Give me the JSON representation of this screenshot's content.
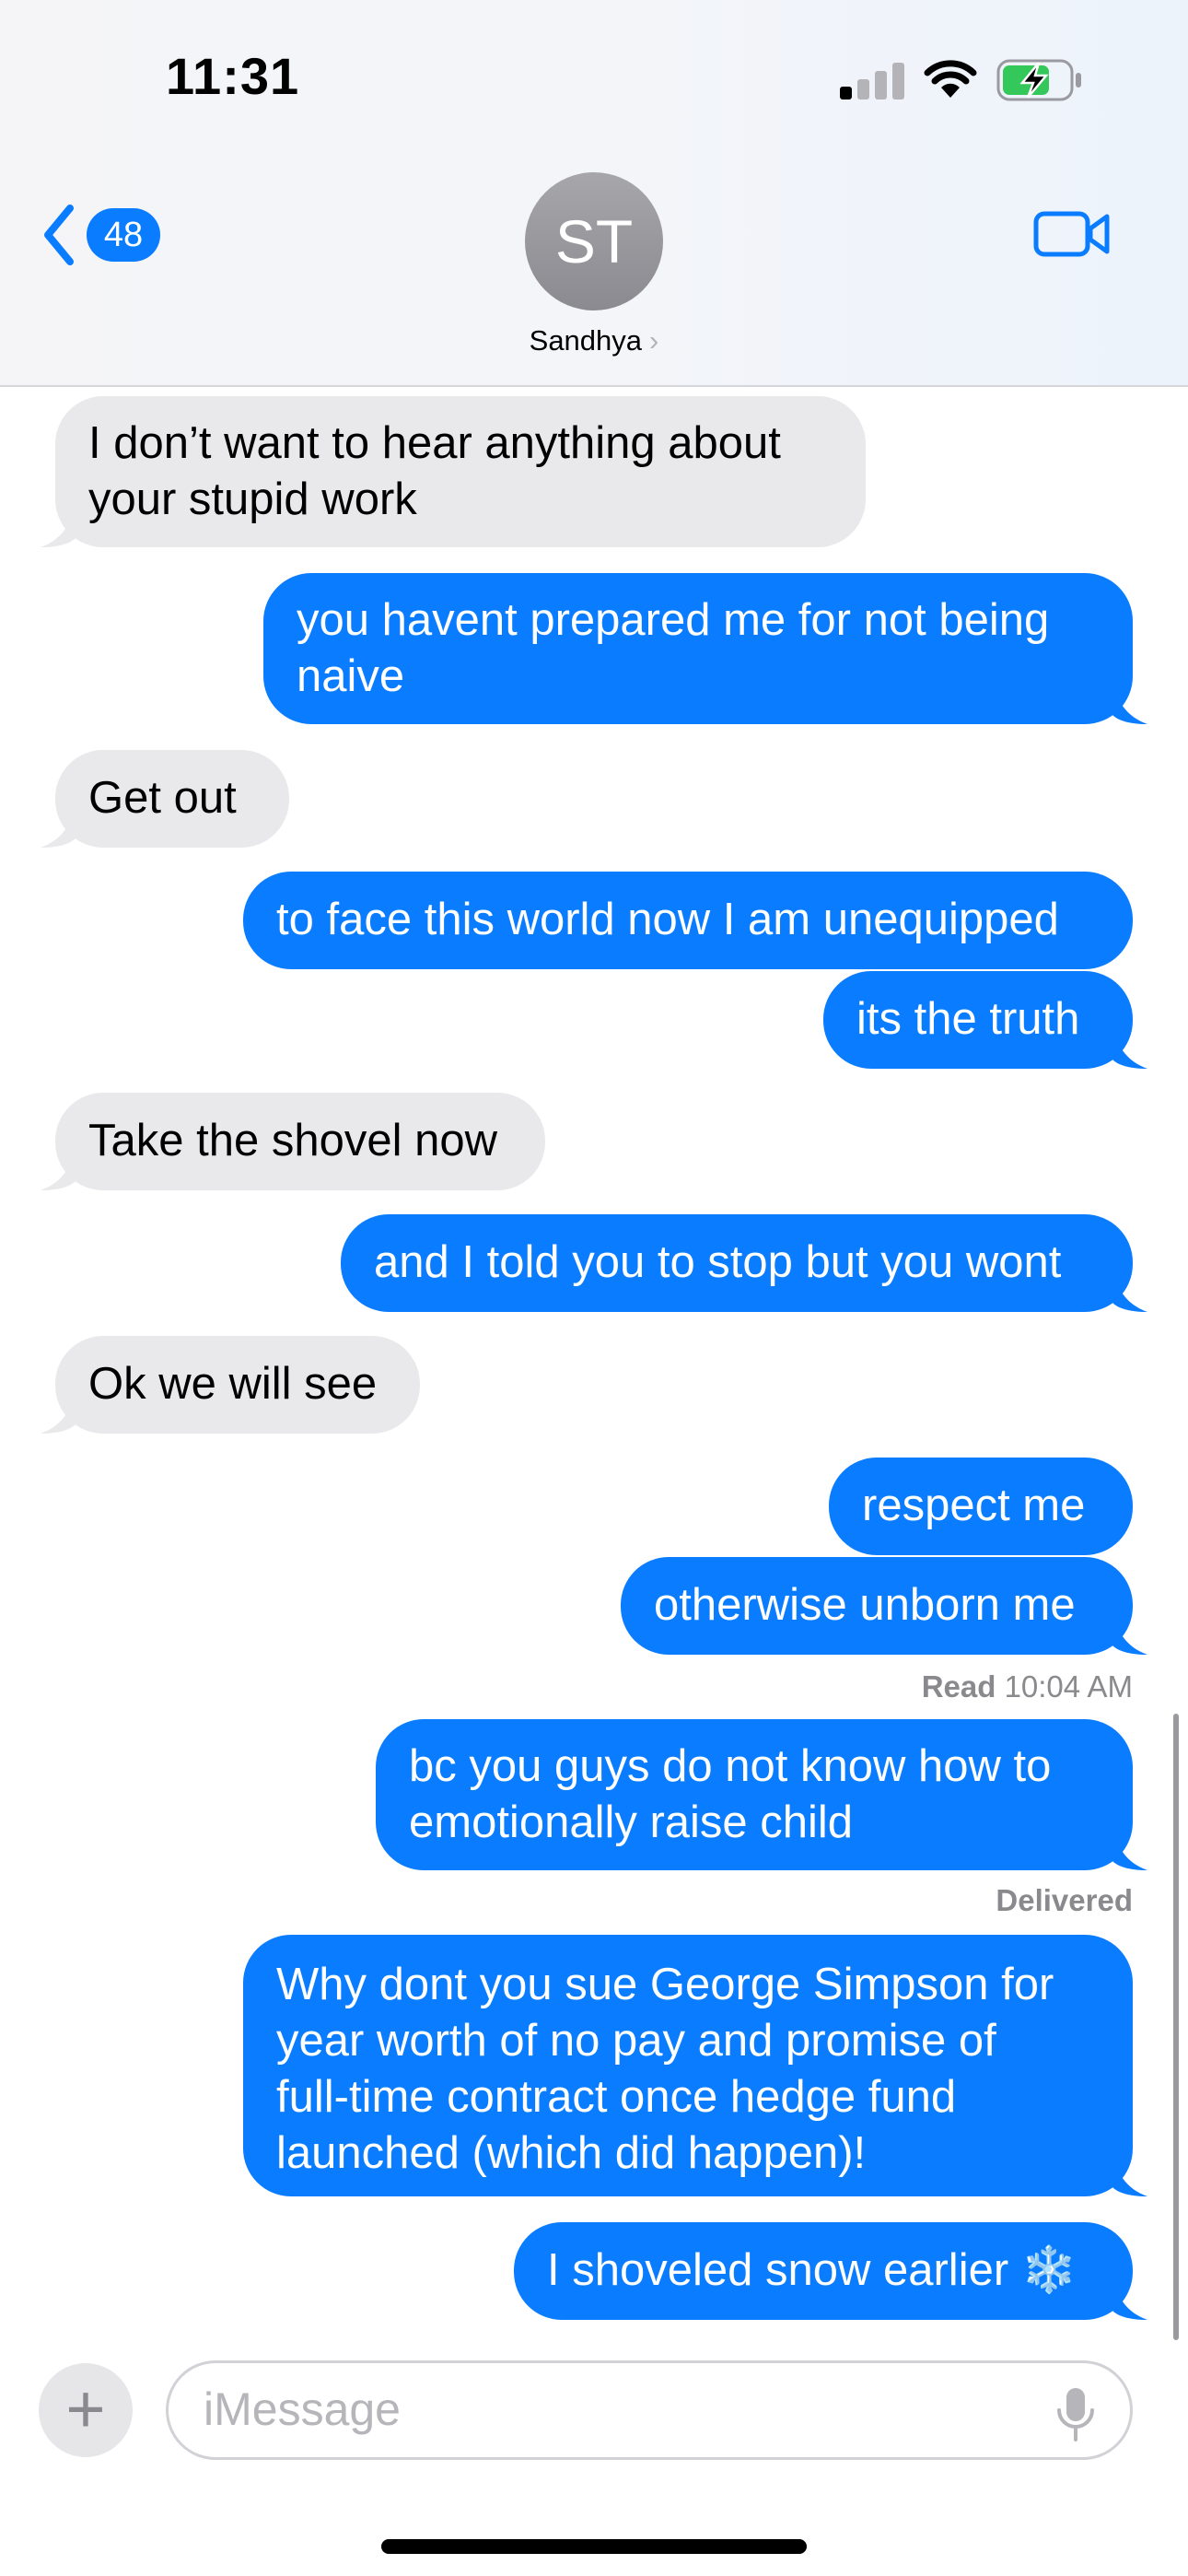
{
  "status_bar": {
    "time": "11:31"
  },
  "nav": {
    "back_count": "48",
    "avatar_initials": "ST",
    "contact_name": "Sandhya",
    "chevron": "›"
  },
  "messages": [
    {
      "from": "them",
      "lines": [
        "I don’t want to hear anything about",
        "your stupid work"
      ]
    },
    {
      "from": "me",
      "lines": [
        "you havent prepared me for not being",
        "naive"
      ]
    },
    {
      "from": "them",
      "lines": [
        "Get out"
      ]
    },
    {
      "from": "me",
      "lines": [
        "to face this world now I am unequipped"
      ]
    },
    {
      "from": "me",
      "lines": [
        "its the truth"
      ]
    },
    {
      "from": "them",
      "lines": [
        "Take the shovel now"
      ]
    },
    {
      "from": "me",
      "lines": [
        "and I told you to stop but you wont"
      ]
    },
    {
      "from": "them",
      "lines": [
        "Ok we will see"
      ]
    },
    {
      "from": "me",
      "lines": [
        "respect me"
      ]
    },
    {
      "from": "me",
      "lines": [
        "otherwise unborn me"
      ]
    },
    {
      "from": "me",
      "lines": [
        "bc you guys do not know how to",
        "emotionally raise child"
      ]
    },
    {
      "from": "me",
      "lines": [
        "Why dont you sue George Simpson for",
        "year worth of no pay and promise of",
        "full-time contract once hedge fund",
        "launched (which did happen)!"
      ]
    },
    {
      "from": "me",
      "lines": [
        "I shoveled snow earlier ❄️"
      ]
    }
  ],
  "receipts": {
    "read_label": "Read",
    "read_time": "10:04 AM",
    "delivered": "Delivered"
  },
  "input": {
    "placeholder": "iMessage",
    "plus": "+"
  },
  "icons": {
    "back": "chevron-left-icon",
    "video": "video-camera-icon",
    "mic": "microphone-icon",
    "plus": "plus-icon",
    "signal": "cellular-signal-icon",
    "wifi": "wifi-icon",
    "battery": "battery-charging-icon"
  },
  "colors": {
    "accent": "#0a7cff",
    "incoming_bubble": "#e9e9eb",
    "battery_charging": "#34c759"
  }
}
